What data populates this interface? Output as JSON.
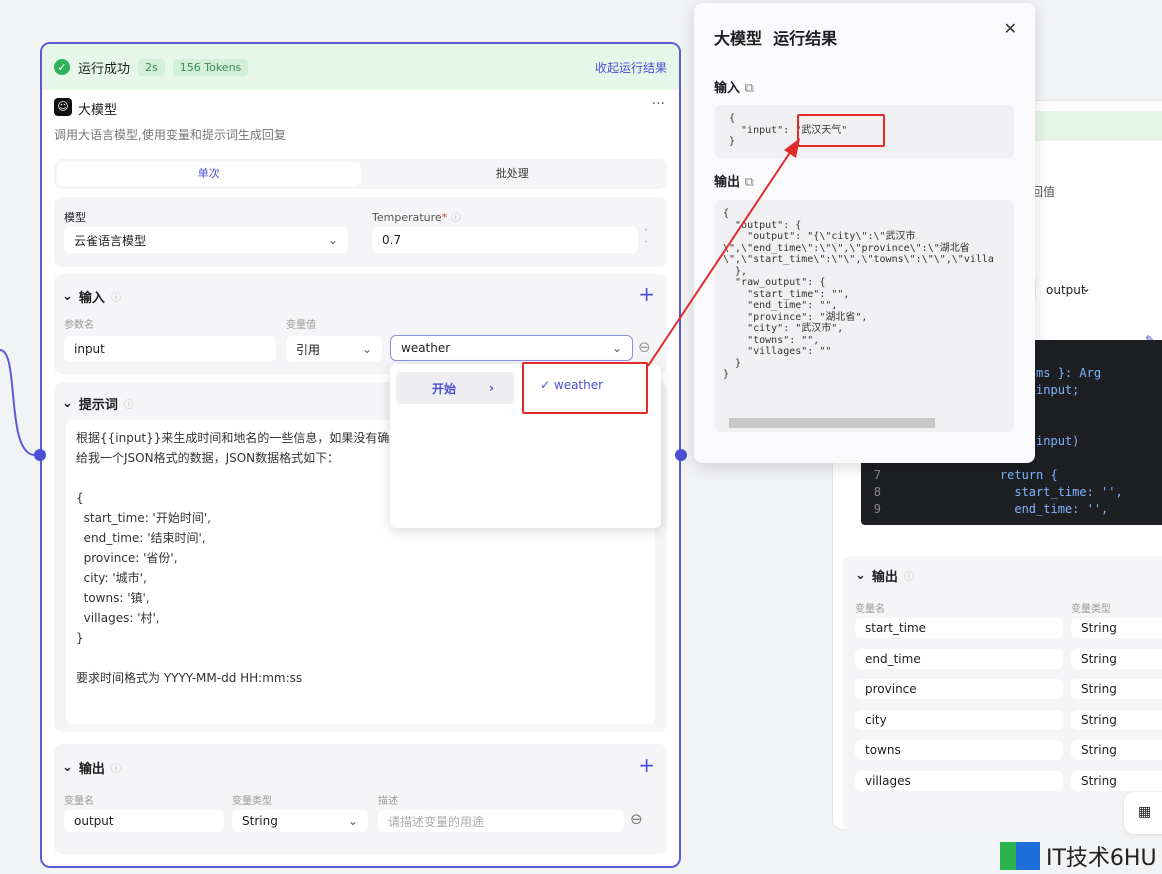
{
  "node": {
    "status": "运行成功",
    "time": "2s",
    "tokens": "156 Tokens",
    "collapse": "收起运行结果",
    "title": "大模型",
    "more": "···",
    "desc": "调用大语言模型,使用变量和提示词生成回复",
    "tabs": [
      "单次",
      "批处理"
    ],
    "model_label": "模型",
    "model_value": "云雀语言模型",
    "temp_label": "Temperature",
    "temp_required": "*",
    "temp_value": "0.7",
    "input": {
      "title": "输入",
      "col_name": "参数名",
      "col_value": "变量值",
      "name": "input",
      "mode": "引用",
      "ref": "weather"
    },
    "dropdown": {
      "group": "开始",
      "option": "weather"
    },
    "prompt": {
      "title": "提示词",
      "lines": [
        "根据{{input}}来生成时间和地名的一些信息，如果没有确定",
        "给我一个JSON格式的数据，JSON数据格式如下：",
        "",
        "{",
        "  start_time: '开始时间',",
        "  end_time: '结束时间',",
        "  province: '省份',",
        "  city: '城市',",
        "  towns: '镇',",
        "  villages: '村',",
        "}",
        "",
        "要求时间格式为 YYYY-MM-dd HH:mm:ss"
      ]
    },
    "output": {
      "title": "输出",
      "col_name": "变量名",
      "col_type": "变量类型",
      "col_desc": "描述",
      "name": "output",
      "type": "String",
      "desc_placeholder": "请描述变量的用途"
    }
  },
  "panel": {
    "title": "大模型  运行结果",
    "input_label": "输入",
    "output_label": "输出",
    "input_code": "{\n  \"input\": \"武汉天气\"\n}",
    "output_code": "{\n  \"output\": {\n    \"output\": \"{\\\"city\\\":\\\"武汉市\n\\\",\\\"end_time\\\":\\\"\\\",\\\"province\\\":\\\"湖北省\n\\\",\\\"start_time\\\":\\\"\\\",\\\"towns\\\":\\\"\\\",\\\"villa\n  },\n  \"raw_output\": {\n    \"start_time\": \"\",\n    \"end_time\": \"\",\n    \"province\": \"湖北省\",\n    \"city\": \"武汉市\",\n    \"towns\": \"\",\n    \"villages\": \"\"\n  }\n}"
  },
  "right": {
    "partial_text": "回值",
    "ref_value": "output",
    "code": [
      {
        "n": "",
        "t": "in({ params }: Arg"
      },
      {
        "n": "",
        "t": "  params.input;"
      },
      {
        "n": "",
        "t": ""
      },
      {
        "n": "",
        "t": ""
      },
      {
        "n": "",
        "t": "ON.parse(input)"
      },
      {
        "n": "",
        "t": ""
      },
      {
        "n": "7",
        "t": "    return {"
      },
      {
        "n": "8",
        "t": "      start_time: '',"
      },
      {
        "n": "9",
        "t": "      end_time: '',"
      }
    ],
    "output_title": "输出",
    "col_name": "变量名",
    "col_type": "变量类型",
    "rows": [
      {
        "name": "start_time",
        "type": "String"
      },
      {
        "name": "end_time",
        "type": "String"
      },
      {
        "name": "province",
        "type": "String"
      },
      {
        "name": "city",
        "type": "String"
      },
      {
        "name": "towns",
        "type": "String"
      },
      {
        "name": "villages",
        "type": "String"
      }
    ]
  },
  "watermark": "IT技术6HU",
  "colors": {
    "accent": "#4c4fd6",
    "success": "#2fb35a",
    "highlight": "#e02b2b"
  }
}
